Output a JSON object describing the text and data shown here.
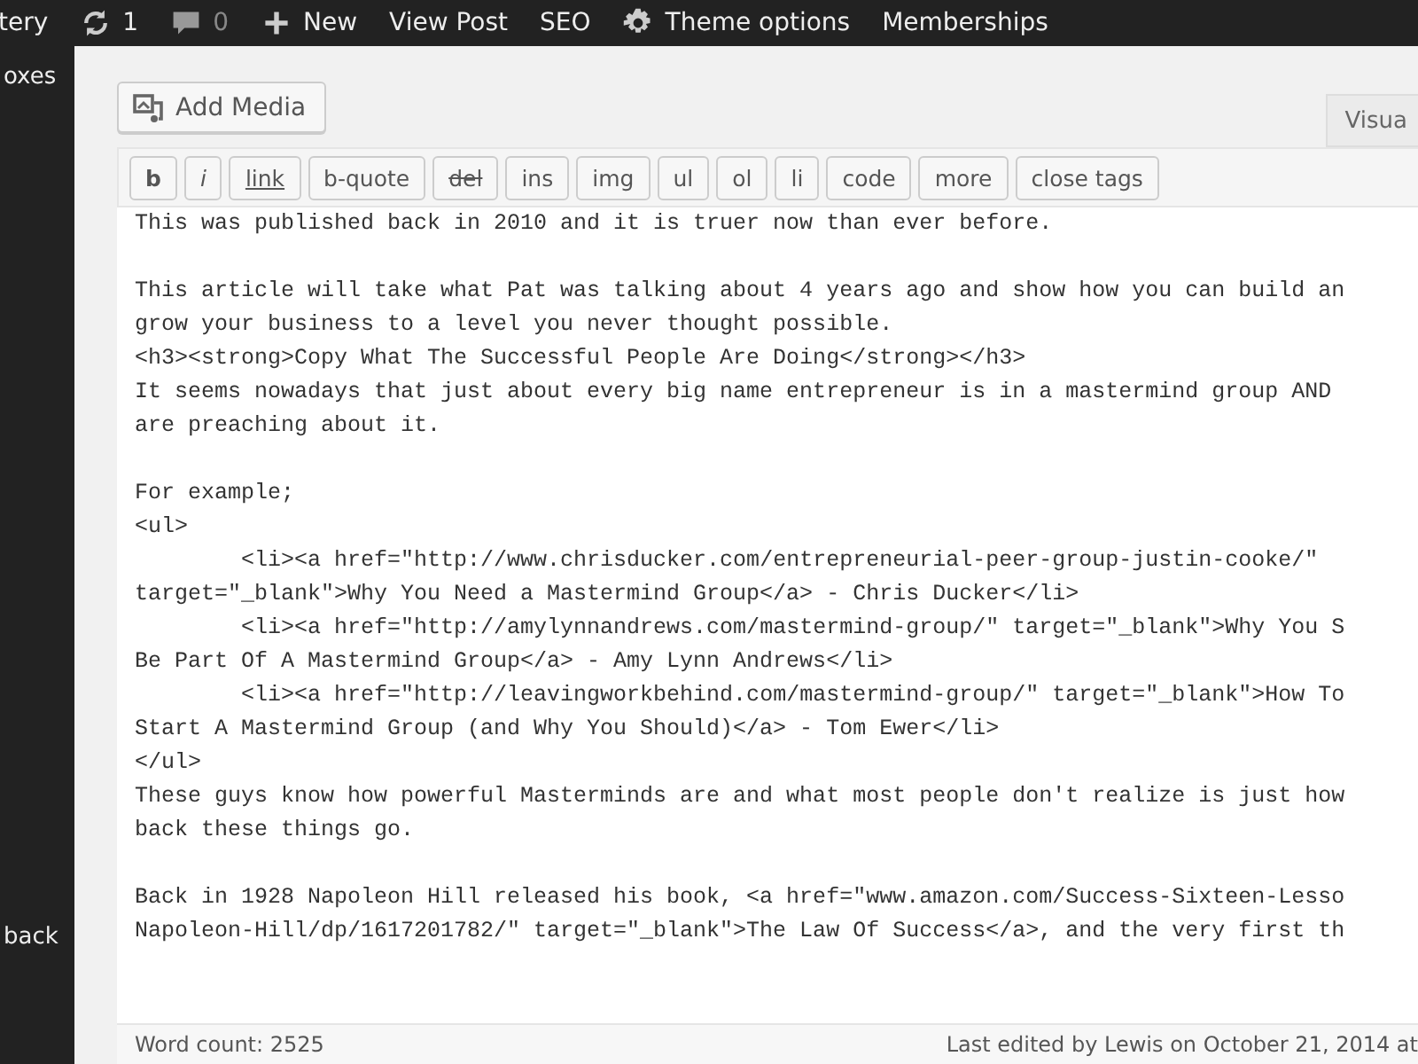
{
  "admin_bar": {
    "items": [
      {
        "kind": "text",
        "label": "tery"
      },
      {
        "kind": "updates",
        "label": "1"
      },
      {
        "kind": "comments",
        "label": "0"
      },
      {
        "kind": "new",
        "label": "New"
      },
      {
        "kind": "text",
        "label": "View Post"
      },
      {
        "kind": "text",
        "label": "SEO"
      },
      {
        "kind": "gear",
        "label": "Theme options"
      },
      {
        "kind": "text",
        "label": "Memberships"
      }
    ]
  },
  "sidebar": {
    "items": [
      "oxes",
      "back"
    ]
  },
  "add_media": {
    "label": "Add Media"
  },
  "editor_tab": {
    "label": "Visua"
  },
  "quicktags": [
    {
      "label": "b",
      "kind": "bold"
    },
    {
      "label": "i",
      "kind": "italic"
    },
    {
      "label": "link",
      "kind": "underline"
    },
    {
      "label": "b-quote",
      "kind": "plain"
    },
    {
      "label": "del",
      "kind": "strike"
    },
    {
      "label": "ins",
      "kind": "plain"
    },
    {
      "label": "img",
      "kind": "plain"
    },
    {
      "label": "ul",
      "kind": "plain"
    },
    {
      "label": "ol",
      "kind": "plain"
    },
    {
      "label": "li",
      "kind": "plain"
    },
    {
      "label": "code",
      "kind": "plain"
    },
    {
      "label": "more",
      "kind": "plain"
    },
    {
      "label": "close tags",
      "kind": "plain"
    }
  ],
  "editor": {
    "paragraphs": [
      [
        "This was published back in 2010 and it is truer now than ever before."
      ],
      [
        "This article will take what Pat was talking about 4 years ago and show how you can build an",
        "grow your business to a level you never thought possible.",
        "<h3><strong>Copy What The Successful People Are Doing</strong></h3>",
        "It seems nowadays that just about every big name entrepreneur is in a mastermind group AND",
        "are preaching about it."
      ],
      [
        "For example;",
        "<ul>",
        "\t<li><a href=\"http://www.chrisducker.com/entrepreneurial-peer-group-justin-cooke/\"",
        "target=\"_blank\">Why You Need a Mastermind Group</a> - Chris Ducker</li>",
        "\t<li><a href=\"http://amylynnandrews.com/mastermind-group/\" target=\"_blank\">Why You S",
        "Be Part Of A Mastermind Group</a> - Amy Lynn Andrews</li>",
        "\t<li><a href=\"http://leavingworkbehind.com/mastermind-group/\" target=\"_blank\">How To",
        "Start A Mastermind Group (and Why You Should)</a> - Tom Ewer</li>",
        "</ul>",
        "These guys know how powerful Masterminds are and what most people don't realize is just how",
        "back these things go."
      ],
      [
        "Back in 1928 Napoleon Hill released his book, <a href=\"www.amazon.com/Success-Sixteen-Lesso",
        "Napoleon-Hill/dp/1617201782/\" target=\"_blank\">The Law Of Success</a>, and the very first th"
      ]
    ]
  },
  "status": {
    "word_count": "Word count: 2525",
    "last_edited": "Last edited by Lewis on October 21, 2014 at"
  }
}
